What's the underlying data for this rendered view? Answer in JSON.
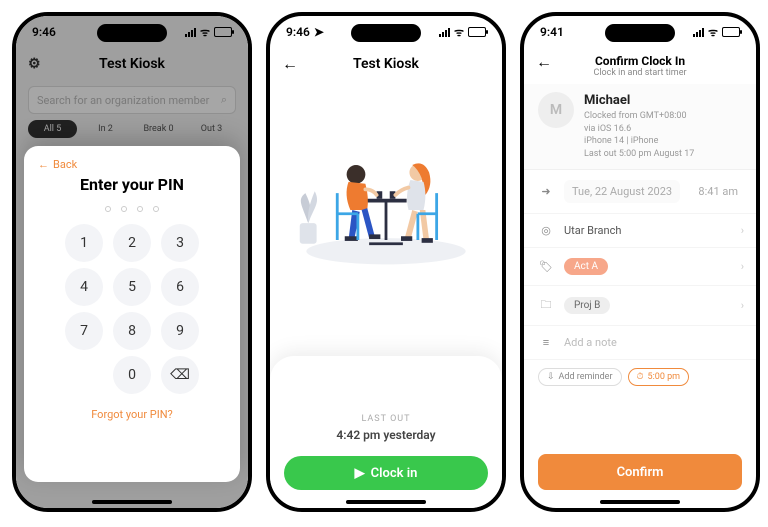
{
  "status": {
    "time1": "9:46",
    "time2": "9:46",
    "time3": "9:41",
    "battery_icon": "battery"
  },
  "phone1": {
    "title": "Test Kiosk",
    "search_placeholder": "Search for an organization member",
    "tabs": {
      "all": "All 5",
      "in": "In 2",
      "break": "Break 0",
      "out": "Out 3"
    },
    "modal": {
      "back": "Back",
      "title": "Enter your PIN",
      "keys": {
        "k1": "1",
        "k2": "2",
        "k3": "3",
        "k4": "4",
        "k5": "5",
        "k6": "6",
        "k7": "7",
        "k8": "8",
        "k9": "9",
        "k0": "0",
        "del": "⌫"
      },
      "forgot": "Forgot your PIN?"
    }
  },
  "phone2": {
    "title": "Test Kiosk",
    "last_out_label": "LAST OUT",
    "last_out_value": "4:42 pm yesterday",
    "clockin": "Clock in"
  },
  "phone3": {
    "title": "Confirm Clock In",
    "subtitle": "Clock in and start timer",
    "user": {
      "initial": "M",
      "name": "Michael",
      "tz": "Clocked from GMT+08:00",
      "os": "via iOS 16.6",
      "device": "iPhone 14 | iPhone",
      "last_out": "Last out 5:00 pm August 17"
    },
    "datetime": {
      "date": "Tue, 22 August 2023",
      "time": "8:41 am"
    },
    "branch": "Utar Branch",
    "activity": "Act A",
    "project": "Proj B",
    "note_placeholder": "Add a note",
    "chips": {
      "reminder": "Add reminder",
      "alarm": "5:00 pm"
    },
    "confirm": "Confirm"
  }
}
